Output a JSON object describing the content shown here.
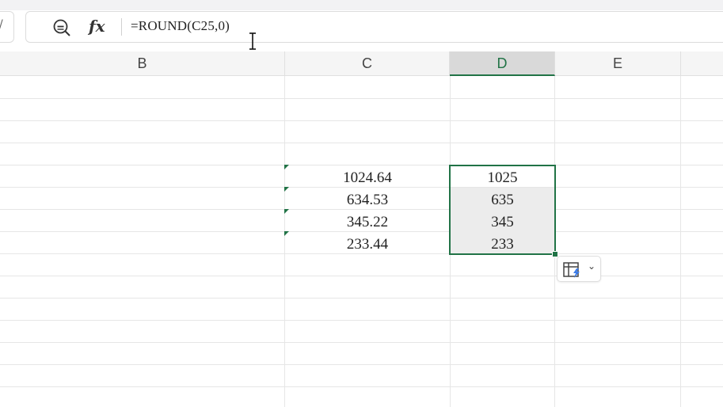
{
  "formula_bar": {
    "formula": "=ROUND(C25,0)",
    "icons": [
      "zoom-out-icon",
      "fx-icon"
    ],
    "fx_label": "fx"
  },
  "columns": [
    {
      "label": "B",
      "selected": false
    },
    {
      "label": "C",
      "selected": false
    },
    {
      "label": "D",
      "selected": true
    },
    {
      "label": "E",
      "selected": false
    }
  ],
  "cells": {
    "c": [
      "1024.64",
      "634.53",
      "345.22",
      "233.44"
    ],
    "d": [
      "1025",
      "635",
      "345",
      "233"
    ]
  },
  "quick_action": {
    "icon": "quick-analysis-icon",
    "dropdown_icon": "chevron-down-icon"
  },
  "colors": {
    "accent": "#217346",
    "header_bg": "#f5f5f5",
    "selected_header_bg": "#d9d9d9"
  }
}
